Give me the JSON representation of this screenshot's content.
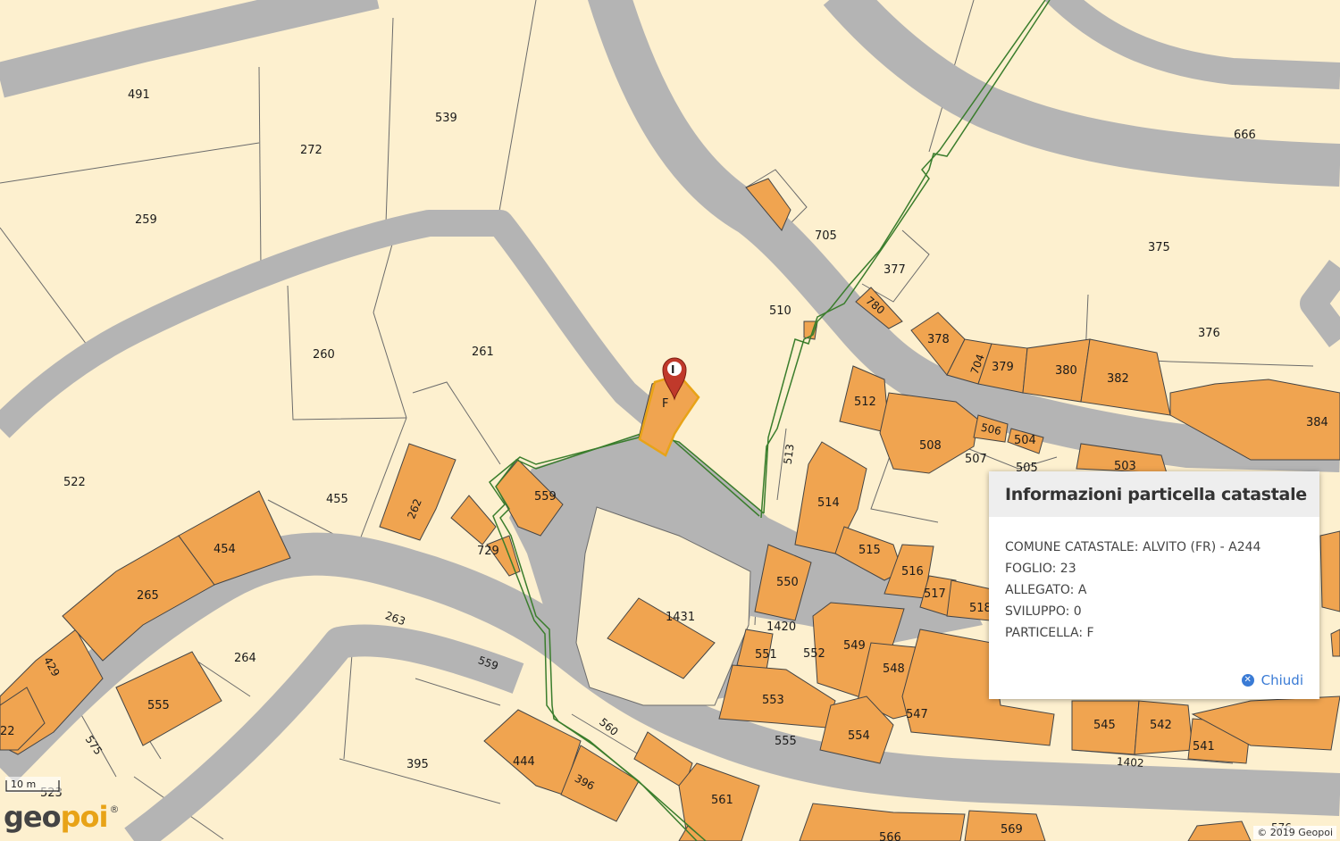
{
  "map": {
    "colors": {
      "parcel": "#fdf0cf",
      "road": "#b4b4b4",
      "building": "#f0a450",
      "route": "#3a7d2c",
      "marker": "#c0392b"
    },
    "parcel_labels": [
      "491",
      "272",
      "539",
      "666",
      "259",
      "705",
      "375",
      "377",
      "780",
      "510",
      "376",
      "260",
      "261",
      "378",
      "704",
      "379",
      "380",
      "382",
      "384",
      "512",
      "506",
      "504",
      "508",
      "507",
      "505",
      "503",
      "522",
      "455",
      "513",
      "262",
      "559",
      "514",
      "454",
      "729",
      "515",
      "516",
      "517",
      "518",
      "265",
      "550",
      "1431",
      "1420",
      "549",
      "552",
      "551",
      "548",
      "264",
      "263",
      "559",
      "429",
      "553",
      "555",
      "547",
      "575",
      "560",
      "545",
      "542",
      "541",
      "1402",
      "395",
      "444",
      "396",
      "561",
      "569",
      "555",
      "554",
      "22",
      "523",
      "576",
      "566"
    ],
    "selected_parcel_label": "F",
    "marker_icon": "info-marker-icon",
    "marker_letter": "I"
  },
  "popup": {
    "title": "Informazioni particella catastale",
    "lines": [
      "COMUNE CATASTALE: ALVITO (FR) - A244",
      "FOGLIO: 23",
      "ALLEGATO: A",
      "SVILUPPO: 0",
      "PARTICELLA: F"
    ],
    "close_icon": "close-circle-icon",
    "close_label": "Chiudi"
  },
  "scale": {
    "label": "10 m"
  },
  "logo": {
    "part1": "geo",
    "part2": "poi",
    "mark": "®"
  },
  "copyright": "© 2019 Geopoi"
}
